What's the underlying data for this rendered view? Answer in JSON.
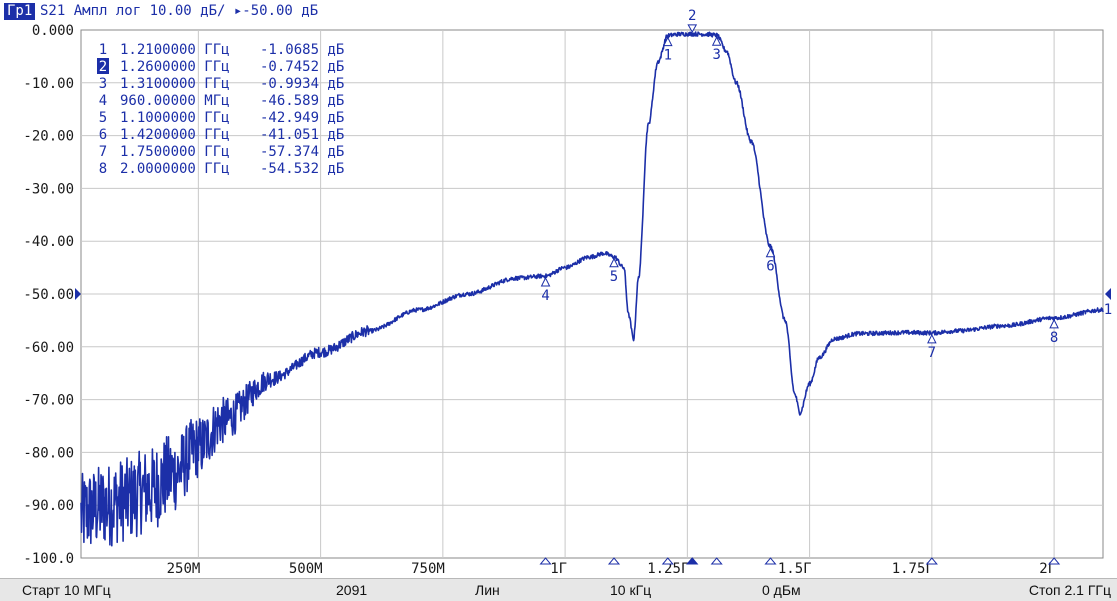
{
  "header": {
    "trace_tag": "Гр1",
    "trace_info": "S21 Ампл лог 10.00 дБ/ ▸-50.00 дБ"
  },
  "y_axis_labels": [
    "0.000",
    "-10.00",
    "-20.00",
    "-30.00",
    "-40.00",
    "-50.00",
    "-60.00",
    "-70.00",
    "-80.00",
    "-90.00",
    "-100.0"
  ],
  "x_axis_labels": [
    "250М",
    "500М",
    "750М",
    "1Г",
    "1.25Г",
    "1.5Г",
    "1.75Г",
    "2Г"
  ],
  "reference_marker_label": "1",
  "marker_table": [
    {
      "num": "1",
      "freq": "1.2100000 ГГц",
      "value": "-1.0685 дБ",
      "active": false
    },
    {
      "num": "2",
      "freq": "1.2600000 ГГц",
      "value": "-0.7452 дБ",
      "active": true
    },
    {
      "num": "3",
      "freq": "1.3100000 ГГц",
      "value": "-0.9934 дБ",
      "active": false
    },
    {
      "num": "4",
      "freq": "960.00000 МГц",
      "value": "-46.589 дБ",
      "active": false
    },
    {
      "num": "5",
      "freq": "1.1000000 ГГц",
      "value": "-42.949 дБ",
      "active": false
    },
    {
      "num": "6",
      "freq": "1.4200000 ГГц",
      "value": "-41.051 дБ",
      "active": false
    },
    {
      "num": "7",
      "freq": "1.7500000 ГГц",
      "value": "-57.374 дБ",
      "active": false
    },
    {
      "num": "8",
      "freq": "2.0000000 ГГц",
      "value": "-54.532 дБ",
      "active": false
    }
  ],
  "status_bar": {
    "start": "Старт 10 МГц",
    "points": "2091",
    "sweep_type": "Лин",
    "if_bandwidth": "10 кГц",
    "power": "0 дБм",
    "stop": "Стоп 2.1 ГГц"
  },
  "colors": {
    "trace": "#1c2fa8",
    "grid": "#c8c8c8",
    "background": "#ffffff",
    "status_bar": "#e7e7e7"
  },
  "chart_data": {
    "type": "line",
    "x_unit": "GHz",
    "y_unit": "dB",
    "xlim": [
      0.01,
      2.1
    ],
    "ylim": [
      -100,
      0
    ],
    "x_grid": [
      0.25,
      0.5,
      0.75,
      1.0,
      1.25,
      1.5,
      1.75,
      2.0
    ],
    "y_grid_step": 10,
    "reference_level": -50,
    "series": [
      {
        "x": [
          0.01,
          0.03,
          0.06,
          0.1,
          0.15,
          0.2,
          0.25,
          0.3,
          0.4,
          0.5,
          0.6,
          0.7,
          0.8,
          0.9,
          0.96,
          1.0,
          1.05,
          1.08,
          1.1,
          1.12,
          1.13,
          1.14,
          1.15,
          1.17,
          1.19,
          1.21,
          1.23,
          1.26,
          1.29,
          1.31,
          1.33,
          1.35,
          1.38,
          1.42,
          1.45,
          1.47,
          1.48,
          1.5,
          1.52,
          1.55,
          1.6,
          1.7,
          1.75,
          1.8,
          1.9,
          2.0,
          2.1
        ],
        "y": [
          -92,
          -91,
          -90,
          -89,
          -87,
          -84,
          -79,
          -74,
          -66,
          -61,
          -57,
          -53,
          -50,
          -47,
          -46.589,
          -45,
          -43,
          -42.3,
          -42.949,
          -45,
          -54,
          -58.5,
          -47,
          -18,
          -6,
          -1.0685,
          -0.8,
          -0.7452,
          -0.8,
          -0.9934,
          -4,
          -10,
          -21,
          -41.051,
          -55,
          -69,
          -72.5,
          -67,
          -62,
          -58.5,
          -57.5,
          -57.3,
          -57.374,
          -57,
          -56,
          -54.532,
          -53
        ]
      }
    ],
    "markers": [
      {
        "num": "1",
        "x": 1.21,
        "y": -1.0685
      },
      {
        "num": "2",
        "x": 1.26,
        "y": -0.7452
      },
      {
        "num": "3",
        "x": 1.31,
        "y": -0.9934
      },
      {
        "num": "4",
        "x": 0.96,
        "y": -46.589
      },
      {
        "num": "5",
        "x": 1.1,
        "y": -42.949
      },
      {
        "num": "6",
        "x": 1.42,
        "y": -41.051
      },
      {
        "num": "7",
        "x": 1.75,
        "y": -57.374
      },
      {
        "num": "8",
        "x": 2.0,
        "y": -54.532
      }
    ]
  }
}
